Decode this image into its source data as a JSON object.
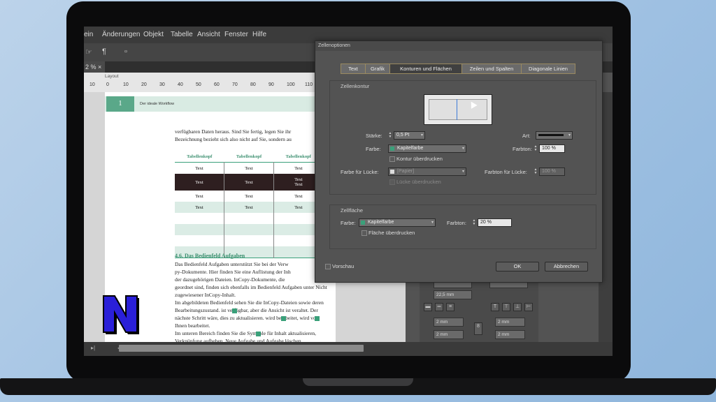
{
  "menubar": {
    "items": [
      "ein",
      "Änderungen",
      "Objekt",
      "Tabelle",
      "Ansicht",
      "Fenster",
      "Hilfe"
    ]
  },
  "toolbar": {
    "icon1": "☞",
    "icon2": "¶",
    "icon3": "▫"
  },
  "tabbar": {
    "tab_label": "2 % ×"
  },
  "ruler": {
    "layer": "Layout",
    "ticks": [
      "10",
      "0",
      "10",
      "20",
      "30",
      "40",
      "50",
      "60",
      "70",
      "80",
      "90",
      "100",
      "110"
    ]
  },
  "page": {
    "chapter_number": "1",
    "chapter_title": "Der ideale Workflow",
    "intro_lines": [
      "verfügbaren Daten heraus. Sind Sie fertig, legen Sie ihr",
      "Bezeichnung bezieht sich also nicht auf Sie, sondern au"
    ],
    "table": {
      "headers": [
        "Tabellenkopf",
        "Tabellenkopf",
        "Tabellenkopf"
      ],
      "rows": [
        [
          "Text",
          "Text",
          "Text"
        ],
        [
          "Text",
          "Text",
          "Text\nText"
        ],
        [
          "Text",
          "Text",
          "Text"
        ],
        [
          "Text",
          "Text",
          "Text"
        ]
      ]
    },
    "section_heading": "4.6.  Das Bedienfeld Aufgaben",
    "body_lines": [
      "Das Bedienfeld Aufgaben unterstützt Sie bei der Verw",
      "py-Dokumente. Hier finden Sie eine Auflistung der Inh",
      "der dazugehörigen Dateien. InCopy-Dokumente, die",
      "geordnet sind, finden sich ebenfalls im Bedienfeld Aufgaben unter Nicht",
      "zugewiesener InCopy-Inhalt.",
      "    Im abgebildeten Bedienfeld sehen Sie die InCopy-Dateien sowie deren",
      "Bearbeitungszustand.    ist verfügbar, aber die Ansicht ist veraltet. Der",
      "nächste Schritt wäre, dies zu aktualisieren.    wird bearbeitet,    wird von",
      "Ihnen bearbeitet.",
      "    Im unteren Bereich finden Sie die Symbole für    Inhalt aktualisieren,",
      "    Verknüpfung aufheben,    Neue Aufgabe und    Aufgabe löschen."
    ]
  },
  "right_panel": {
    "field1": "22,5 mm",
    "top": "2 mm",
    "bottom": "2 mm",
    "left": "2 mm",
    "right": "2 mm"
  },
  "dialog": {
    "title": "Zellenoptionen",
    "tabs": [
      "Text",
      "Grafik",
      "Konturen und Flächen",
      "Zeilen und Spalten",
      "Diagonale Linien"
    ],
    "active_tab": "Konturen und Flächen",
    "cell_stroke": {
      "section": "Zellenkontur",
      "weight_label": "Stärke:",
      "weight_value": "0,5 Pt",
      "type_label": "Art:",
      "color_label": "Farbe:",
      "color_value": "Kapitelfarbe",
      "tint_label": "Farbton:",
      "tint_value": "100 %",
      "overprint_label": "Kontur überdrucken",
      "gap_color_label": "Farbe für Lücke:",
      "gap_color_value": "[Papier]",
      "gap_tint_label": "Farbton für Lücke:",
      "gap_tint_value": "100 %",
      "gap_overprint_label": "Lücke überdrucken"
    },
    "cell_fill": {
      "section": "Zellfläche",
      "color_label": "Farbe:",
      "color_value": "Kapitelfarbe",
      "tint_label": "Farbton:",
      "tint_value": "20 %",
      "overprint_label": "Fläche überdrucken"
    },
    "preview_label": "Vorschau",
    "ok_label": "OK",
    "cancel_label": "Abbrechen"
  },
  "colors": {
    "accent": "#3aa07a",
    "dark_row": "#2e1f20",
    "logo_blue": "#2a1fd8"
  }
}
